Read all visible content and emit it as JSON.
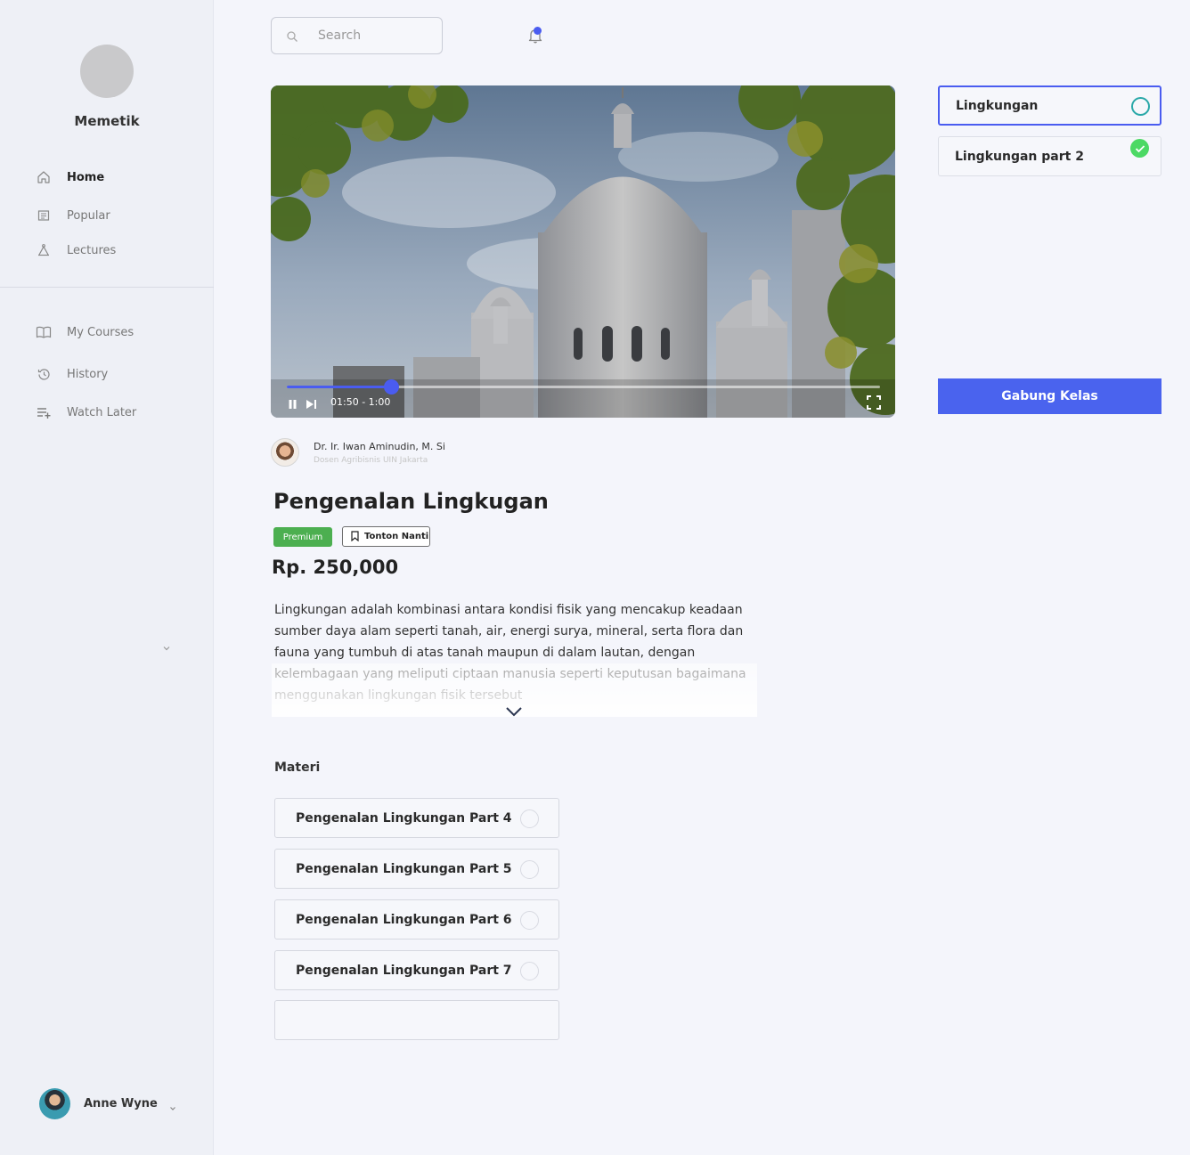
{
  "brand": {
    "name": "Memetik"
  },
  "nav": {
    "primary": [
      {
        "label": "Home",
        "icon": "home-icon",
        "active": true
      },
      {
        "label": "Popular",
        "icon": "popular-icon",
        "active": false
      },
      {
        "label": "Lectures",
        "icon": "lectures-icon",
        "active": false
      }
    ],
    "secondary": [
      {
        "label": "My Courses",
        "icon": "book-icon"
      },
      {
        "label": "History",
        "icon": "history-icon"
      },
      {
        "label": "Watch Later",
        "icon": "playlist-add-icon"
      }
    ]
  },
  "user": {
    "name": "Anne Wyne"
  },
  "search": {
    "placeholder": "Search"
  },
  "video": {
    "time": "01:50 - 1:00",
    "progress": 0.175
  },
  "instructor": {
    "name": "Dr. Ir. Iwan Aminudin, M. Si",
    "role": "Dosen Agribisnis UIN Jakarta"
  },
  "course": {
    "title": "Pengenalan Lingkugan",
    "badge": "Premium",
    "watch_later": "Tonton Nanti",
    "price": "Rp. 250,000",
    "description": "Lingkungan adalah kombinasi antara kondisi fisik yang mencakup keadaan sumber daya alam seperti tanah, air, energi surya, mineral, serta flora dan fauna yang tumbuh di atas tanah maupun di dalam lautan, dengan kelembagaan yang meliputi ciptaan manusia  seperti keputusan  bagaimana menggunakan lingkungan fisik tersebut"
  },
  "materi": {
    "title": "Materi",
    "items": [
      {
        "label": "Pengenalan Lingkungan Part 4"
      },
      {
        "label": "Pengenalan Lingkungan Part 5"
      },
      {
        "label": "Pengenalan Lingkungan Part 6"
      },
      {
        "label": "Pengenalan Lingkungan Part 7"
      },
      {
        "label": ""
      }
    ]
  },
  "lessons": [
    {
      "label": "Lingkungan",
      "state": "current"
    },
    {
      "label": "Lingkungan part 2",
      "state": "completed"
    }
  ],
  "join_button": "Gabung Kelas",
  "colors": {
    "accent": "#4a5cf0",
    "premium": "#4caf50",
    "completed": "#4cd964",
    "current_ring": "#29a8a8"
  }
}
